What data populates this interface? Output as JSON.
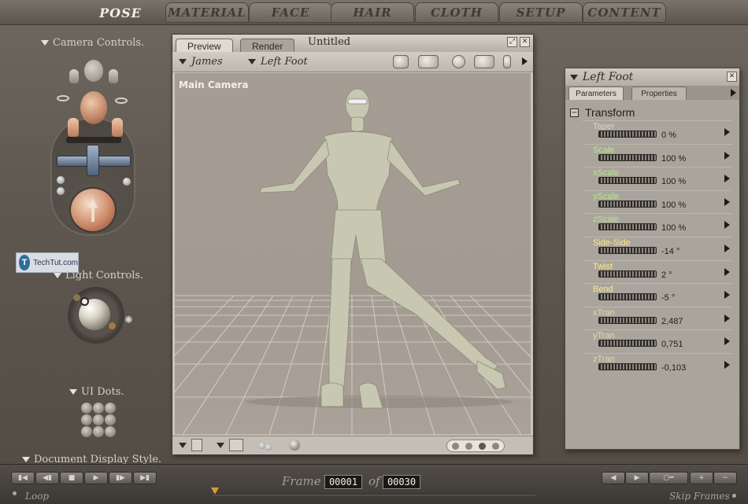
{
  "tabs": [
    "POSE",
    "MATERIAL",
    "FACE",
    "HAIR",
    "CLOTH",
    "SETUP",
    "CONTENT"
  ],
  "active_tab": "POSE",
  "left_panel": {
    "camera_controls": "Camera Controls.",
    "light_controls": "Light Controls.",
    "ui_dots": "UI Dots.",
    "document_display_style": "Document Display Style."
  },
  "watermark": {
    "text": "TechTut.com",
    "logo": "T"
  },
  "preview": {
    "tabs": [
      "Preview",
      "Render"
    ],
    "doc_title": "Untitled",
    "figure_menu": "James",
    "actor_menu": "Left Foot",
    "camera_label": "Main Camera"
  },
  "params": {
    "actor": "Left Foot",
    "tabs": [
      "Parameters",
      "Properties"
    ],
    "group": "Transform",
    "rows": [
      {
        "name": "Taper",
        "value": "0 %",
        "color": "#d7d2c8"
      },
      {
        "name": "Scale",
        "value": "100 %",
        "color": "#b9e58c"
      },
      {
        "name": "xScale",
        "value": "100 %",
        "color": "#b9e58c"
      },
      {
        "name": "yScale",
        "value": "100 %",
        "color": "#b9e58c"
      },
      {
        "name": "zScale",
        "value": "100 %",
        "color": "#b9e58c"
      },
      {
        "name": "Side-Side",
        "value": "-14 °",
        "color": "#ffe58a"
      },
      {
        "name": "Twist",
        "value": "2 °",
        "color": "#ffe58a"
      },
      {
        "name": "Bend",
        "value": "-5 °",
        "color": "#ffe58a"
      },
      {
        "name": "xTran",
        "value": "2,487",
        "color": "#e8d6a8"
      },
      {
        "name": "yTran",
        "value": "0,751",
        "color": "#e8d6a8"
      },
      {
        "name": "zTran",
        "value": "-0,103",
        "color": "#e8d6a8"
      }
    ]
  },
  "bottom": {
    "frame_label": "Frame",
    "current_frame": "00001",
    "of_label": "of",
    "total_frames": "00030",
    "loop": "Loop",
    "skip_frames": "Skip Frames"
  }
}
